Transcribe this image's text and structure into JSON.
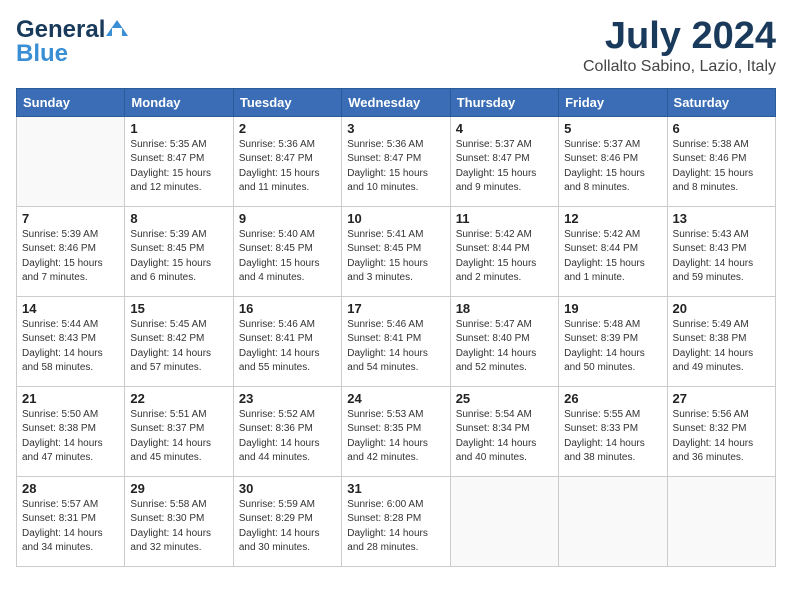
{
  "logo": {
    "general": "General",
    "blue": "Blue"
  },
  "title": {
    "month_year": "July 2024",
    "location": "Collalto Sabino, Lazio, Italy"
  },
  "days_of_week": [
    "Sunday",
    "Monday",
    "Tuesday",
    "Wednesday",
    "Thursday",
    "Friday",
    "Saturday"
  ],
  "weeks": [
    [
      {
        "day": "",
        "info": ""
      },
      {
        "day": "1",
        "info": "Sunrise: 5:35 AM\nSunset: 8:47 PM\nDaylight: 15 hours\nand 12 minutes."
      },
      {
        "day": "2",
        "info": "Sunrise: 5:36 AM\nSunset: 8:47 PM\nDaylight: 15 hours\nand 11 minutes."
      },
      {
        "day": "3",
        "info": "Sunrise: 5:36 AM\nSunset: 8:47 PM\nDaylight: 15 hours\nand 10 minutes."
      },
      {
        "day": "4",
        "info": "Sunrise: 5:37 AM\nSunset: 8:47 PM\nDaylight: 15 hours\nand 9 minutes."
      },
      {
        "day": "5",
        "info": "Sunrise: 5:37 AM\nSunset: 8:46 PM\nDaylight: 15 hours\nand 8 minutes."
      },
      {
        "day": "6",
        "info": "Sunrise: 5:38 AM\nSunset: 8:46 PM\nDaylight: 15 hours\nand 8 minutes."
      }
    ],
    [
      {
        "day": "7",
        "info": "Sunrise: 5:39 AM\nSunset: 8:46 PM\nDaylight: 15 hours\nand 7 minutes."
      },
      {
        "day": "8",
        "info": "Sunrise: 5:39 AM\nSunset: 8:45 PM\nDaylight: 15 hours\nand 6 minutes."
      },
      {
        "day": "9",
        "info": "Sunrise: 5:40 AM\nSunset: 8:45 PM\nDaylight: 15 hours\nand 4 minutes."
      },
      {
        "day": "10",
        "info": "Sunrise: 5:41 AM\nSunset: 8:45 PM\nDaylight: 15 hours\nand 3 minutes."
      },
      {
        "day": "11",
        "info": "Sunrise: 5:42 AM\nSunset: 8:44 PM\nDaylight: 15 hours\nand 2 minutes."
      },
      {
        "day": "12",
        "info": "Sunrise: 5:42 AM\nSunset: 8:44 PM\nDaylight: 15 hours\nand 1 minute."
      },
      {
        "day": "13",
        "info": "Sunrise: 5:43 AM\nSunset: 8:43 PM\nDaylight: 14 hours\nand 59 minutes."
      }
    ],
    [
      {
        "day": "14",
        "info": "Sunrise: 5:44 AM\nSunset: 8:43 PM\nDaylight: 14 hours\nand 58 minutes."
      },
      {
        "day": "15",
        "info": "Sunrise: 5:45 AM\nSunset: 8:42 PM\nDaylight: 14 hours\nand 57 minutes."
      },
      {
        "day": "16",
        "info": "Sunrise: 5:46 AM\nSunset: 8:41 PM\nDaylight: 14 hours\nand 55 minutes."
      },
      {
        "day": "17",
        "info": "Sunrise: 5:46 AM\nSunset: 8:41 PM\nDaylight: 14 hours\nand 54 minutes."
      },
      {
        "day": "18",
        "info": "Sunrise: 5:47 AM\nSunset: 8:40 PM\nDaylight: 14 hours\nand 52 minutes."
      },
      {
        "day": "19",
        "info": "Sunrise: 5:48 AM\nSunset: 8:39 PM\nDaylight: 14 hours\nand 50 minutes."
      },
      {
        "day": "20",
        "info": "Sunrise: 5:49 AM\nSunset: 8:38 PM\nDaylight: 14 hours\nand 49 minutes."
      }
    ],
    [
      {
        "day": "21",
        "info": "Sunrise: 5:50 AM\nSunset: 8:38 PM\nDaylight: 14 hours\nand 47 minutes."
      },
      {
        "day": "22",
        "info": "Sunrise: 5:51 AM\nSunset: 8:37 PM\nDaylight: 14 hours\nand 45 minutes."
      },
      {
        "day": "23",
        "info": "Sunrise: 5:52 AM\nSunset: 8:36 PM\nDaylight: 14 hours\nand 44 minutes."
      },
      {
        "day": "24",
        "info": "Sunrise: 5:53 AM\nSunset: 8:35 PM\nDaylight: 14 hours\nand 42 minutes."
      },
      {
        "day": "25",
        "info": "Sunrise: 5:54 AM\nSunset: 8:34 PM\nDaylight: 14 hours\nand 40 minutes."
      },
      {
        "day": "26",
        "info": "Sunrise: 5:55 AM\nSunset: 8:33 PM\nDaylight: 14 hours\nand 38 minutes."
      },
      {
        "day": "27",
        "info": "Sunrise: 5:56 AM\nSunset: 8:32 PM\nDaylight: 14 hours\nand 36 minutes."
      }
    ],
    [
      {
        "day": "28",
        "info": "Sunrise: 5:57 AM\nSunset: 8:31 PM\nDaylight: 14 hours\nand 34 minutes."
      },
      {
        "day": "29",
        "info": "Sunrise: 5:58 AM\nSunset: 8:30 PM\nDaylight: 14 hours\nand 32 minutes."
      },
      {
        "day": "30",
        "info": "Sunrise: 5:59 AM\nSunset: 8:29 PM\nDaylight: 14 hours\nand 30 minutes."
      },
      {
        "day": "31",
        "info": "Sunrise: 6:00 AM\nSunset: 8:28 PM\nDaylight: 14 hours\nand 28 minutes."
      },
      {
        "day": "",
        "info": ""
      },
      {
        "day": "",
        "info": ""
      },
      {
        "day": "",
        "info": ""
      }
    ]
  ]
}
